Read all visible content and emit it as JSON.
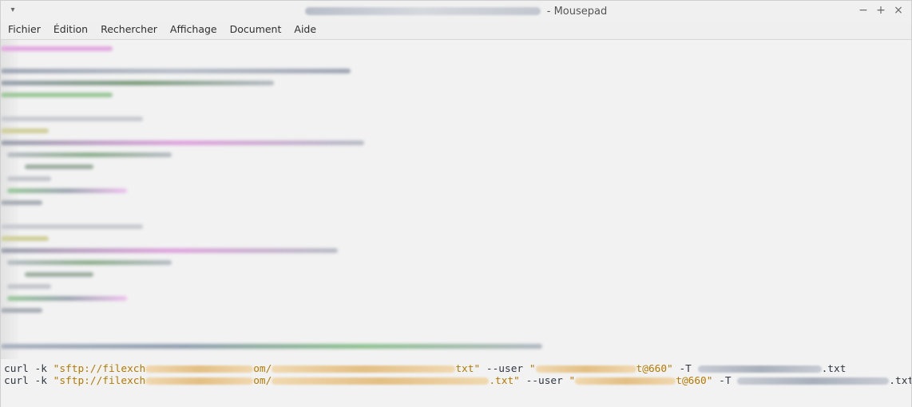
{
  "window": {
    "app_name": "Mousepad",
    "title_separator": "- Mousepad"
  },
  "menu": {
    "items": [
      "Fichier",
      "Édition",
      "Rechercher",
      "Affichage",
      "Document",
      "Aide"
    ]
  },
  "editor": {
    "lines": [
      {
        "prefix": "curl -k ",
        "str_start": "\"sftp://filexch",
        "str_mid1": "om/",
        "str_mid2": "txt\"",
        "opt": " --user ",
        "user_start": "\"",
        "user_end": "t@660\"",
        "opt2": " -T ",
        "file_end": ".txt"
      },
      {
        "prefix": "curl -k ",
        "str_start": "\"sftp://filexch",
        "str_mid1": "om/",
        "str_mid2": ".txt\"",
        "opt": " --user ",
        "user_start": "\"",
        "user_end": "t@660\"",
        "opt2": " -T ",
        "file_end": ".txt"
      }
    ]
  },
  "colors": {
    "string": "#b37a00",
    "text": "#2f3640",
    "background": "#f2f2f2"
  }
}
